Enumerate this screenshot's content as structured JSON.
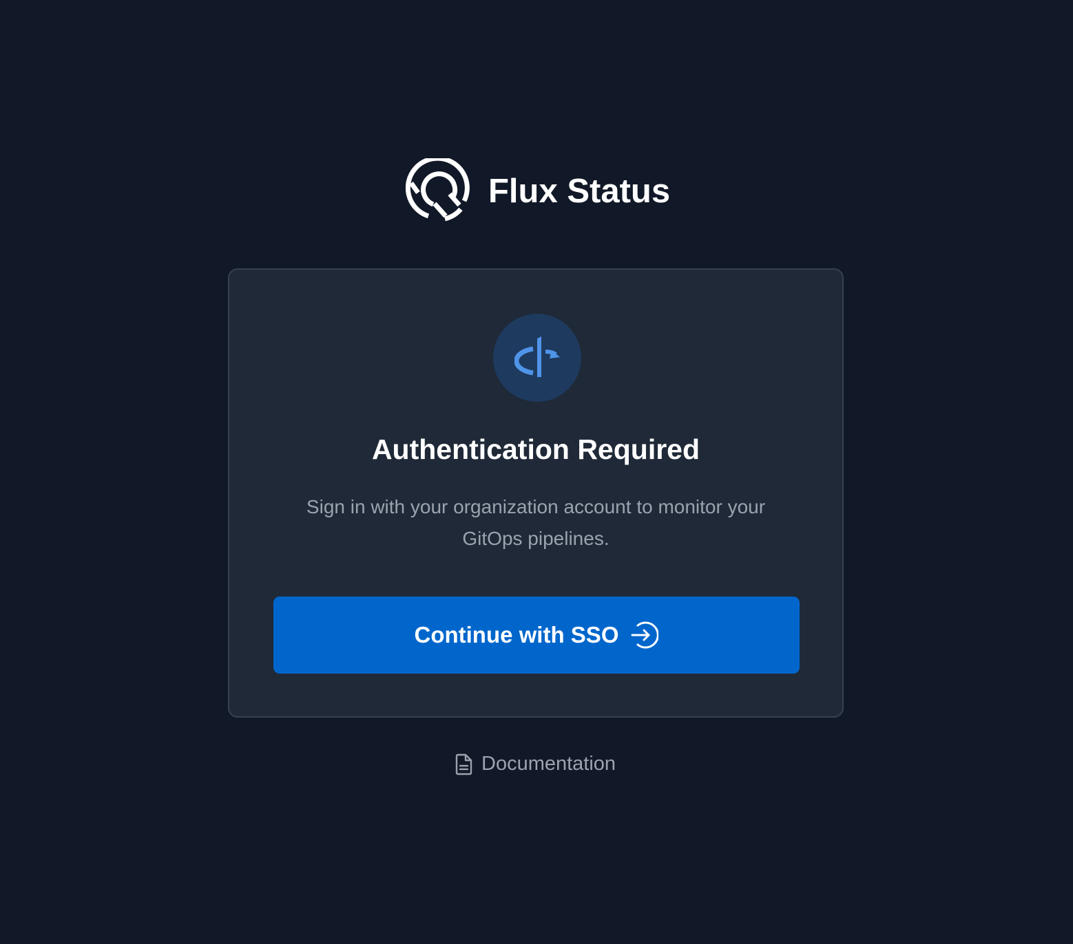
{
  "brand": {
    "title": "Flux Status",
    "logo_icon": "flux-sync-logo"
  },
  "auth_card": {
    "provider_icon": "openid-icon",
    "title": "Authentication Required",
    "subtitle": "Sign in with your organization account to monitor your GitOps pipelines.",
    "sso_button": {
      "label": "Continue with SSO",
      "icon": "sign-in-arrow-icon"
    }
  },
  "footer": {
    "documentation_label": "Documentation",
    "documentation_icon": "document-icon"
  },
  "colors": {
    "background": "#111827",
    "card_background": "#1f2937",
    "card_border": "#374151",
    "accent": "#0066cc",
    "provider_icon_bg": "#1e3a5f",
    "provider_icon": "#4f94e8",
    "muted_text": "#9ca3af"
  }
}
